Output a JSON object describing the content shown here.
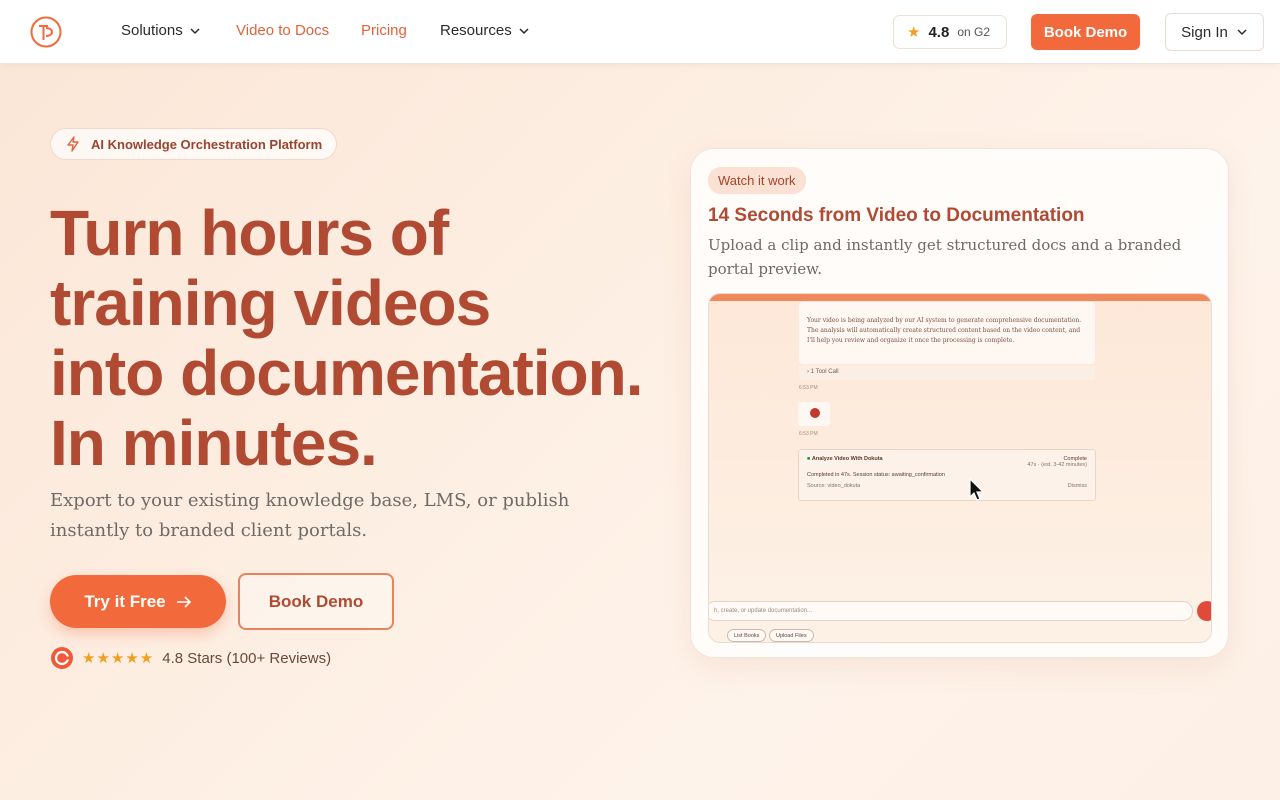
{
  "nav": {
    "items": [
      {
        "label": "Solutions",
        "has_dropdown": true
      },
      {
        "label": "Video to Docs",
        "has_dropdown": false
      },
      {
        "label": "Pricing",
        "has_dropdown": false
      },
      {
        "label": "Resources",
        "has_dropdown": true
      }
    ],
    "rating": {
      "score": "4.8",
      "on": "on G2",
      "icon": "star-icon"
    },
    "demo_label": "Book Demo",
    "signin_label": "Sign In"
  },
  "hero": {
    "badge": "AI Knowledge Orchestration Platform",
    "title_lines": [
      "Turn hours of",
      "training videos",
      "into documentation.",
      "In minutes."
    ],
    "subtitle": "Export to your existing knowledge base, LMS, or publish instantly to branded client portals.",
    "try_label": "Try it Free",
    "demo_label": "Book Demo",
    "reviews": {
      "stars": "★★★★★",
      "text": "4.8 Stars (100+ Reviews)"
    }
  },
  "card": {
    "tag": "Watch it work",
    "title": "14 Seconds from Video to Documentation",
    "description": "Upload a clip and instantly get structured docs and a branded portal preview.",
    "preview": {
      "message": "Your video is being analyzed by our AI system to generate comprehensive documentation. The analysis will automatically create structured content based on the video content, and I'll help you review and organize it once the processing is complete.",
      "tool_call": "1 Tool Call",
      "time1": "6:53 PM",
      "time2": "6:53 PM",
      "analyze_title": "Analyze Video With Dokuta",
      "analyze_status": "Complete",
      "analyze_status_detail": "47s · (est. 3-42 minutes)",
      "analyze_meta": "Session status: awaiting_confirmation",
      "analyze_progress": "Completed in 47s. Session status: awaiting_confirmation",
      "analyze_source": "Source: video_dokuta",
      "analyze_dismiss": "Dismiss",
      "input_placeholder": "h, create, or update documentation...",
      "chips": [
        "List Books",
        "Upload Files"
      ]
    }
  },
  "colors": {
    "accent": "#f26a3b",
    "title": "#b04a33",
    "background": "#fdeee2"
  }
}
